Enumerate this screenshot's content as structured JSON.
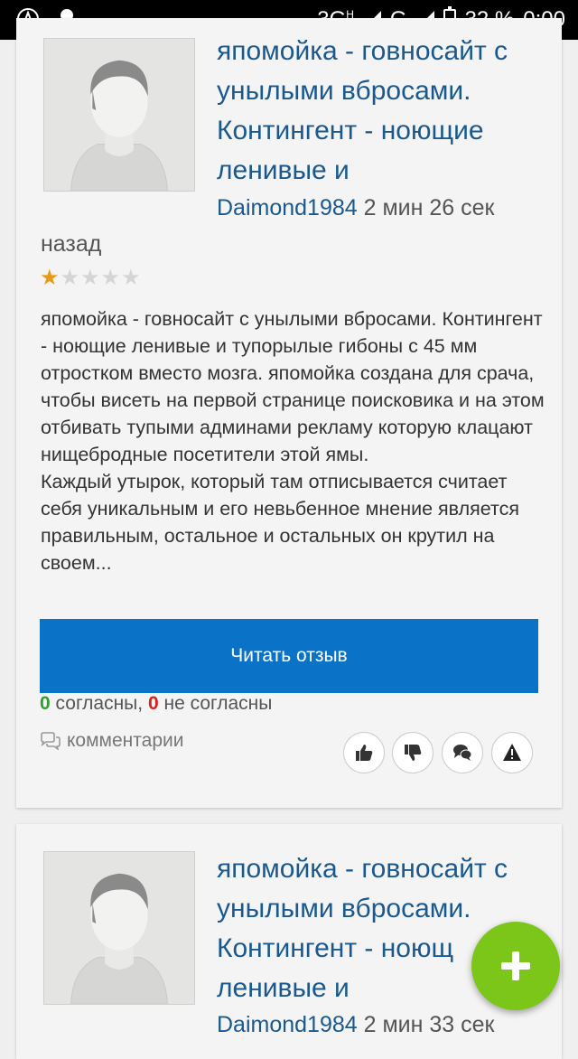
{
  "status_bar": {
    "network": "3G",
    "network_sup": "H",
    "network2": "G",
    "battery": "32 %",
    "time": "0:00",
    "icons": [
      "app-a-icon",
      "octopus-icon",
      "signal-icon",
      "battery-icon"
    ]
  },
  "reviews": [
    {
      "title": "япомойка - говносайт с унылыми вбросами. Контингент - ноющие ленивые и",
      "author": "Daimond1984",
      "ago_part1": "2 мин 26 сек",
      "ago_part2": "назад",
      "rating": 1,
      "rating_max": 5,
      "text_p1": "япомойка - говносайт с унылыми вбросами. Контингент - ноющие ленивые и тупорылые гибоны с 45 мм отростком вместо мозга. япомойка создана для срача, чтобы висеть на первой странице поисковика и на этом отбивать тупыми админами рекламу которую клацают нищебродные посетители этой ямы.",
      "text_p2": "Каждый утырок, который там отписывается считает себя уникальным и его невьбенное мнение является правильным, остальное и остальных он крутил на своем...",
      "read_label": "Читать отзыв",
      "agree_count": "0",
      "agree_label": "согласны,",
      "disagree_count": "0",
      "disagree_label": "не согласны",
      "comments_label": "комментарии"
    },
    {
      "title": "япомойка - говносайт с унылыми вбросами. Контингент - ноющ ленивые и",
      "author": "Daimond1984",
      "ago_part1": "2 мин 33 сек"
    }
  ],
  "colors": {
    "accent": "#0b73c7",
    "title": "#19598f",
    "star_on": "#e69a14",
    "agree": "#2f9e2f",
    "disagree": "#d42020",
    "fab": "#7cc619"
  }
}
